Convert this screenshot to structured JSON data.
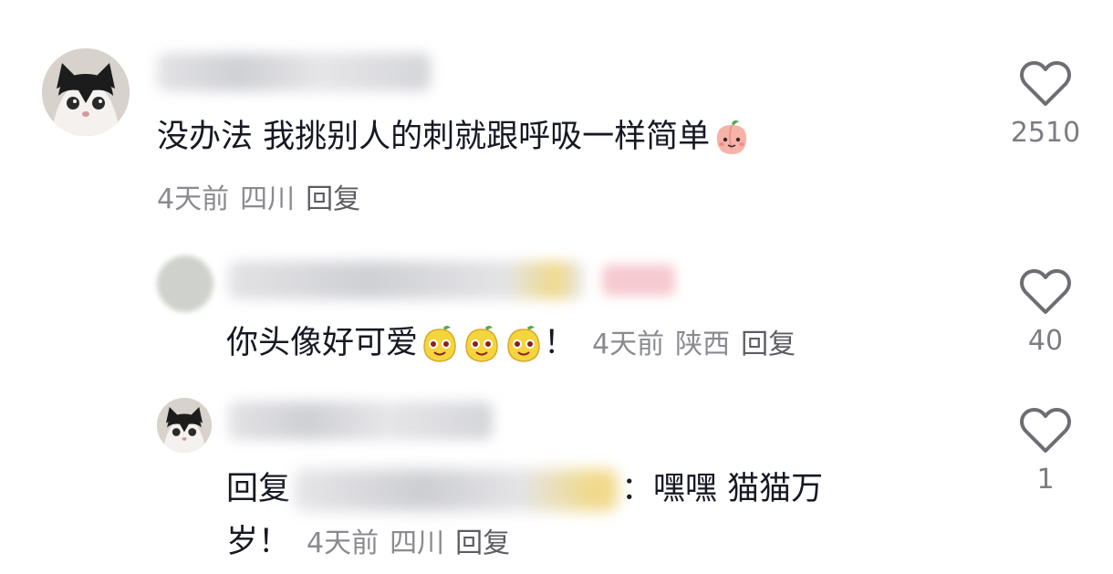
{
  "comments": [
    {
      "text": "没办法 我挑别人的刺就跟呼吸一样简单",
      "meta": {
        "time": "4天前",
        "location": "四川",
        "reply": "回复"
      },
      "likes": "2510"
    },
    {
      "text": "你头像好可爱",
      "exclaim": "！",
      "meta": {
        "time": "4天前",
        "location": "陕西",
        "reply": "回复"
      },
      "likes": "40"
    },
    {
      "reply_prefix": "回复",
      "text_after": "：嘿嘿 猫猫万",
      "text_line2": "岁！",
      "meta": {
        "time": "4天前",
        "location": "四川",
        "reply": "回复"
      },
      "likes": "1"
    }
  ],
  "icons": [
    "heart-outline-icon",
    "peach-emoji-icon",
    "lemon-face-emoji-icon"
  ],
  "colors": {
    "text": "#161823",
    "meta": "#8a8b91",
    "like_count": "#7c7d83"
  }
}
